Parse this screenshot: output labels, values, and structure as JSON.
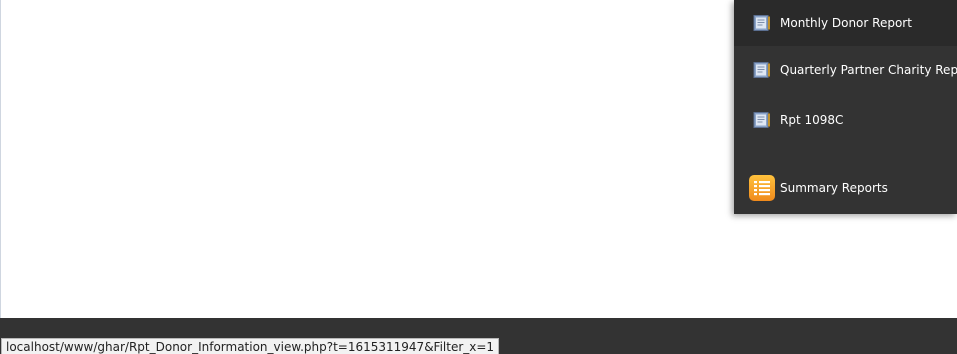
{
  "menu": {
    "items": [
      {
        "label": "Monthly Donor Report",
        "icon": "report-book-icon"
      },
      {
        "label": "Quarterly Partner Charity Report",
        "icon": "report-book-icon"
      },
      {
        "label": "Rpt 1098C",
        "icon": "report-book-icon"
      },
      {
        "label": "Summary Reports",
        "icon": "summary-list-icon"
      }
    ]
  },
  "status_bar": {
    "url": "localhost/www/ghar/Rpt_Donor_Information_view.php?t=1615311947&Filter_x=1"
  },
  "colors": {
    "menu_bg": "#333333",
    "menu_hover_bg": "#2a2a2a",
    "footer_bg": "#333333",
    "summary_icon": "#f5a623"
  }
}
